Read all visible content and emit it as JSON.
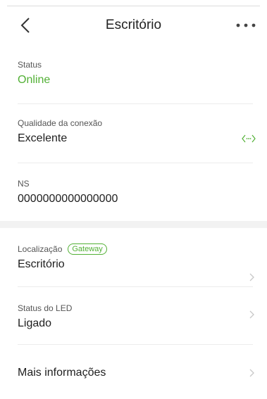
{
  "header": {
    "title": "Escritório",
    "back_icon": "chevron-left-icon",
    "more_icon": "more-dots-icon"
  },
  "rows": {
    "status": {
      "label": "Status",
      "value": "Online"
    },
    "connection": {
      "label": "Qualidade da conexão",
      "value": "Excelente",
      "icon": "signal-code-icon"
    },
    "ns": {
      "label": "NS",
      "value": "0000000000000000"
    },
    "location": {
      "label": "Localização",
      "badge": "Gateway",
      "value": "Escritório"
    },
    "led": {
      "label": "Status do LED",
      "value": "Ligado"
    },
    "more_info": {
      "value": "Mais informações"
    }
  },
  "colors": {
    "accent": "#52b035",
    "divider": "#ececec",
    "band": "#f2f2f2"
  }
}
